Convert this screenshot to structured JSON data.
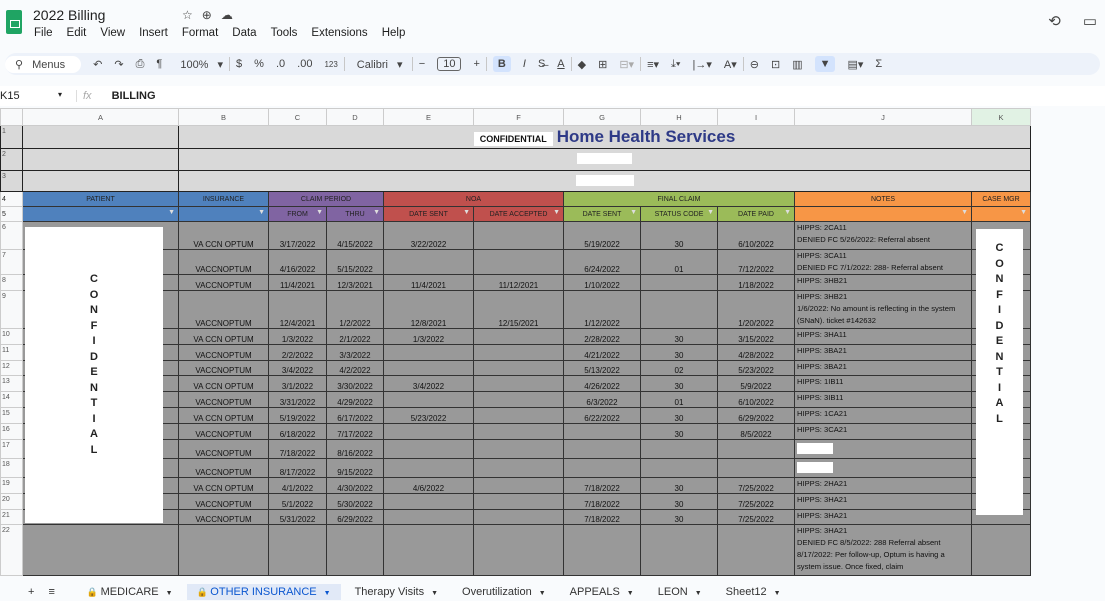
{
  "app": {
    "title": "2022 Billing",
    "menus": [
      "File",
      "Edit",
      "View",
      "Insert",
      "Format",
      "Data",
      "Tools",
      "Extensions",
      "Help"
    ]
  },
  "toolbar": {
    "search": "Menus",
    "zoom": "100%",
    "currency": "$",
    "percent": "%",
    "dec_less": ".0",
    "dec_more": ".00",
    "format_123": "123",
    "font": "Calibri",
    "font_size": "10",
    "bold": "B",
    "italic": "I"
  },
  "formula_bar": {
    "cell_ref": "K15",
    "fx": "fx",
    "value": "BILLING"
  },
  "columns": [
    "A",
    "B",
    "C",
    "D",
    "E",
    "F",
    "G",
    "H",
    "I",
    "J",
    "K"
  ],
  "sheet": {
    "confidential_label": "CONFIDENTIAL",
    "title": "Home Health Services",
    "groups": {
      "patient": "PATIENT",
      "insurance": "INSURANCE",
      "claim_period": "CLAIM PERIOD",
      "noa": "NOA",
      "final_claim": "FINAL CLAIM",
      "notes": "NOTES",
      "case_mgr": "CASE MGR"
    },
    "subheaders": {
      "from": "FROM",
      "thru": "THRU",
      "noa_sent": "DATE SENT",
      "noa_accepted": "DATE ACCEPTED",
      "fc_sent": "DATE SENT",
      "status": "STATUS CODE",
      "paid": "DATE PAID"
    },
    "patient_redacted": "CONFIDENTIAL",
    "case_mgr_redacted": "CONFIDENTIAL",
    "rows": [
      {
        "ins": "VA CCN OPTUM",
        "from": "3/17/2022",
        "thru": "4/15/2022",
        "noa_sent": "3/22/2022",
        "noa_acc": "",
        "fc_sent": "5/19/2022",
        "status": "30",
        "paid": "6/10/2022",
        "notes": "HIPPS: 2CA11\nDENIED FC 5/26/2022: Referral absent"
      },
      {
        "ins": "VACCNOPTUM",
        "from": "4/16/2022",
        "thru": "5/15/2022",
        "noa_sent": "",
        "noa_acc": "",
        "fc_sent": "6/24/2022",
        "status": "01",
        "paid": "7/12/2022",
        "notes": "HIPPS: 3CA11\nDENIED FC 7/1/2022: 288- Referral absent"
      },
      {
        "ins": "VACCNOPTUM",
        "from": "11/4/2021",
        "thru": "12/3/2021",
        "noa_sent": "11/4/2021",
        "noa_acc": "11/12/2021",
        "fc_sent": "1/10/2022",
        "status": "",
        "paid": "1/18/2022",
        "notes": "HIPPS: 3HB21"
      },
      {
        "ins": "VACCNOPTUM",
        "from": "12/4/2021",
        "thru": "1/2/2022",
        "noa_sent": "12/8/2021",
        "noa_acc": "12/15/2021",
        "fc_sent": "1/12/2022",
        "status": "",
        "paid": "1/20/2022",
        "notes": "HIPPS: 3HB21\n1/6/2022: No amount is reflecting in the system (SNaN). ticket #142632"
      },
      {
        "ins": "VA CCN OPTUM",
        "from": "1/3/2022",
        "thru": "2/1/2022",
        "noa_sent": "1/3/2022",
        "noa_acc": "",
        "fc_sent": "2/28/2022",
        "status": "30",
        "paid": "3/15/2022",
        "notes": "HIPPS: 3HA11"
      },
      {
        "ins": "VACCNOPTUM",
        "from": "2/2/2022",
        "thru": "3/3/2022",
        "noa_sent": "",
        "noa_acc": "",
        "fc_sent": "4/21/2022",
        "status": "30",
        "paid": "4/28/2022",
        "notes": "HIPPS: 3BA21"
      },
      {
        "ins": "VACCNOPTUM",
        "from": "3/4/2022",
        "thru": "4/2/2022",
        "noa_sent": "",
        "noa_acc": "",
        "fc_sent": "5/13/2022",
        "status": "02",
        "paid": "5/23/2022",
        "notes": "HIPPS: 3BA21"
      },
      {
        "ins": "VA CCN OPTUM",
        "from": "3/1/2022",
        "thru": "3/30/2022",
        "noa_sent": "3/4/2022",
        "noa_acc": "",
        "fc_sent": "4/26/2022",
        "status": "30",
        "paid": "5/9/2022",
        "notes": "HIPPS: 1IB11"
      },
      {
        "ins": "VACCNOPTUM",
        "from": "3/31/2022",
        "thru": "4/29/2022",
        "noa_sent": "",
        "noa_acc": "",
        "fc_sent": "6/3/2022",
        "status": "01",
        "paid": "6/10/2022",
        "notes": "HIPPS: 3IB11"
      },
      {
        "ins": "VA CCN OPTUM",
        "from": "5/19/2022",
        "thru": "6/17/2022",
        "noa_sent": "5/23/2022",
        "noa_acc": "",
        "fc_sent": "6/22/2022",
        "status": "30",
        "paid": "6/29/2022",
        "notes": "HIPPS: 1CA21"
      },
      {
        "ins": "VACCNOPTUM",
        "from": "6/18/2022",
        "thru": "7/17/2022",
        "noa_sent": "",
        "noa_acc": "",
        "fc_sent": "",
        "status": "30",
        "paid": "8/5/2022",
        "notes": "HIPPS: 3CA21"
      },
      {
        "ins": "VACCNOPTUM",
        "from": "7/18/2022",
        "thru": "8/16/2022",
        "noa_sent": "",
        "noa_acc": "",
        "fc_sent": "",
        "status": "",
        "paid": "",
        "notes": ""
      },
      {
        "ins": "VACCNOPTUM",
        "from": "8/17/2022",
        "thru": "9/15/2022",
        "noa_sent": "",
        "noa_acc": "",
        "fc_sent": "",
        "status": "",
        "paid": "",
        "notes": ""
      },
      {
        "ins": "VA CCN OPTUM",
        "from": "4/1/2022",
        "thru": "4/30/2022",
        "noa_sent": "4/6/2022",
        "noa_acc": "",
        "fc_sent": "7/18/2022",
        "status": "30",
        "paid": "7/25/2022",
        "notes": "HIPPS: 2HA21"
      },
      {
        "ins": "VACCNOPTUM",
        "from": "5/1/2022",
        "thru": "5/30/2022",
        "noa_sent": "",
        "noa_acc": "",
        "fc_sent": "7/18/2022",
        "status": "30",
        "paid": "7/25/2022",
        "notes": "HIPPS: 3HA21"
      },
      {
        "ins": "VACCNOPTUM",
        "from": "5/31/2022",
        "thru": "6/29/2022",
        "noa_sent": "",
        "noa_acc": "",
        "fc_sent": "7/18/2022",
        "status": "30",
        "paid": "7/25/2022",
        "notes": "HIPPS: 3HA21"
      },
      {
        "ins": "",
        "from": "",
        "thru": "",
        "noa_sent": "",
        "noa_acc": "",
        "fc_sent": "",
        "status": "",
        "paid": "",
        "notes": "HIPPS: 3HA21\nDENIED FC 8/5/2022: 288 Referral absent\n8/17/2022: Per follow-up, Optum is having a system issue. Once fixed, claim"
      }
    ]
  },
  "tabs": [
    {
      "label": "MEDICARE",
      "locked": true
    },
    {
      "label": "OTHER INSURANCE",
      "locked": true,
      "active": true
    },
    {
      "label": "Therapy Visits"
    },
    {
      "label": "Overutilization"
    },
    {
      "label": "APPEALS"
    },
    {
      "label": "LEON"
    },
    {
      "label": "Sheet12"
    }
  ]
}
